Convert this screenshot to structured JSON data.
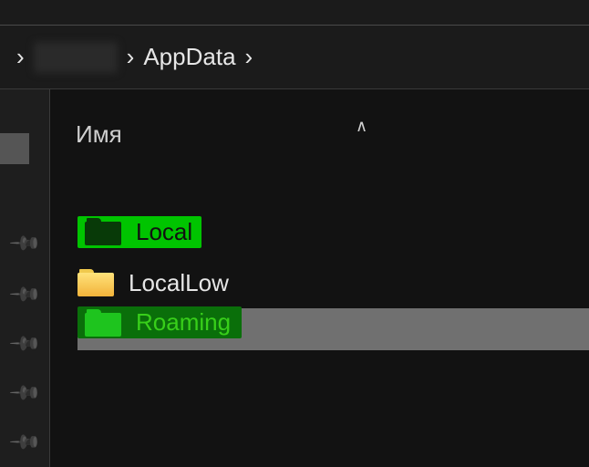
{
  "breadcrumb": {
    "segments": [
      "",
      "AppData"
    ],
    "has_blurred_user": true
  },
  "columns": {
    "name_header": "Имя"
  },
  "folders": [
    {
      "name": "Local",
      "style": "green-highlight",
      "selected": false
    },
    {
      "name": "LocalLow",
      "style": "normal",
      "selected": false
    },
    {
      "name": "Roaming",
      "style": "green-on-grey",
      "selected": true
    }
  ],
  "quick_access_pins": 5
}
